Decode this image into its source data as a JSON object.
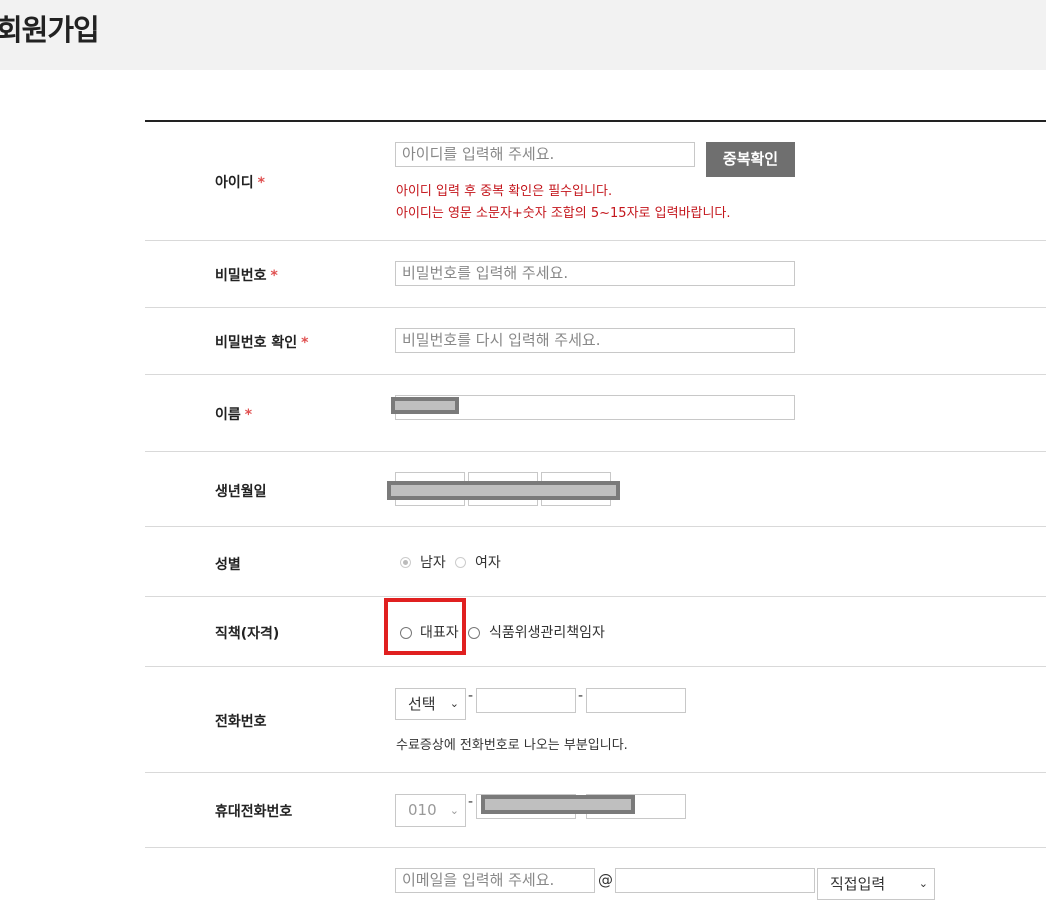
{
  "page": {
    "title": "회원가입"
  },
  "fields": {
    "id": {
      "label": "아이디",
      "required": "*",
      "placeholder": "아이디를 입력해 주세요.",
      "button": "중복확인",
      "error1": "아이디 입력 후 중복 확인은 필수입니다.",
      "error2": "아이디는 영문 소문자+숫자 조합의 5~15자로 입력바랍니다."
    },
    "password": {
      "label": "비밀번호",
      "required": "*",
      "placeholder": "비밀번호를 입력해 주세요."
    },
    "password_confirm": {
      "label": "비밀번호 확인",
      "required": "*",
      "placeholder": "비밀번호를 다시 입력해 주세요."
    },
    "name": {
      "label": "이름",
      "required": "*"
    },
    "birth": {
      "label": "생년월일"
    },
    "gender": {
      "label": "성별",
      "options": [
        "남자",
        "여자"
      ],
      "selected": "남자"
    },
    "position": {
      "label": "직책(자격)",
      "options": [
        "대표자",
        "식품위생관리책임자"
      ]
    },
    "phone": {
      "label": "전화번호",
      "select": "선택",
      "dash": "-",
      "note": "수료증상에 전화번호로 나오는 부분입니다."
    },
    "mobile": {
      "label": "휴대전화번호",
      "select": "010",
      "dash": "-"
    },
    "email": {
      "placeholder": "이메일을 입력해 주세요.",
      "at": "@",
      "domain_select": "직접입력"
    }
  }
}
